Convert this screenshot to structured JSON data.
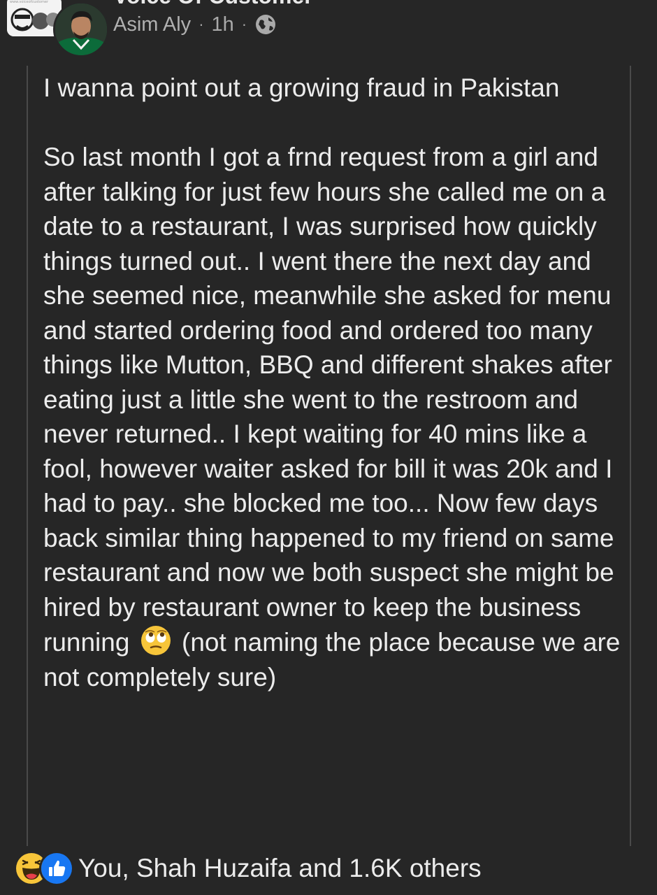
{
  "group": {
    "name": "Voice Of Customer",
    "badge_caption": "www.voiceofcustomer"
  },
  "post": {
    "author": "Asim Aly",
    "time": "1h",
    "separator": "·",
    "privacy_icon": "globe-icon",
    "paragraph_1": "I wanna point out a growing fraud in Pakistan",
    "paragraph_2_before_emoji": "So last month I got a frnd request from a girl and after talking for just few hours she called me on a date to a restaurant, I was surprised how quickly things turned out.. I went there the next day and she seemed nice, meanwhile she asked for menu and started ordering food and ordered too many things like Mutton, BBQ and different shakes after eating just a little she went to the restroom and never returned.. I kept waiting for 40 mins like a fool, however waiter asked for bill it was 20k and I had to pay.. she blocked me too... Now few days back similar thing happened to my friend on same restaurant and now we both suspect she might be hired by restaurant owner to keep the business running",
    "inline_emoji": "eye-roll-emoji",
    "paragraph_2_after_emoji": "(not naming the place because we are not completely sure)"
  },
  "reactions": {
    "icons": [
      "haha-reaction-icon",
      "like-reaction-icon"
    ],
    "summary": "You, Shah Huzaifa and 1.6K others"
  },
  "colors": {
    "background": "#262626",
    "text": "#ececec",
    "meta": "#a9a9a9",
    "like_blue": "#1877f2",
    "haha_yellow": "#f7c53a"
  }
}
